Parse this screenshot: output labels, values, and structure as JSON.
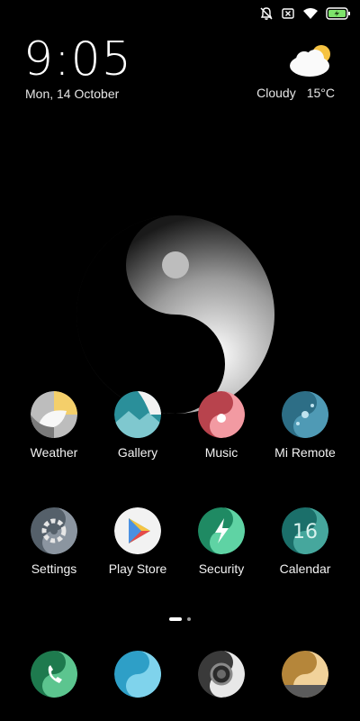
{
  "lockscreen": {
    "time": "9:05",
    "date": "Mon, 14 October"
  },
  "weather": {
    "condition": "Cloudy",
    "temperature": "15°C",
    "icon": "cloud-sun-icon"
  },
  "status_icons": [
    "bell-off-icon",
    "sim-x-icon",
    "wifi-icon",
    "battery-charging-icon"
  ],
  "apps_row1": [
    {
      "label": "Weather",
      "icon": "weather-app-icon"
    },
    {
      "label": "Gallery",
      "icon": "gallery-app-icon"
    },
    {
      "label": "Music",
      "icon": "music-app-icon"
    },
    {
      "label": "Mi Remote",
      "icon": "mi-remote-app-icon"
    }
  ],
  "apps_row2": [
    {
      "label": "Settings",
      "icon": "settings-app-icon"
    },
    {
      "label": "Play Store",
      "icon": "play-store-app-icon"
    },
    {
      "label": "Security",
      "icon": "security-app-icon"
    },
    {
      "label": "Calendar",
      "icon": "calendar-app-icon",
      "day": "16"
    }
  ],
  "dock": [
    "phone-app-icon",
    "messages-app-icon",
    "camera-app-icon",
    "notes-app-icon"
  ],
  "pages": {
    "total": 2,
    "current": 1
  },
  "colors": {
    "background": "#000000",
    "battery": "#7ee36b",
    "accent_teal": "#2a8f9a",
    "accent_green": "#2fbf8f"
  }
}
